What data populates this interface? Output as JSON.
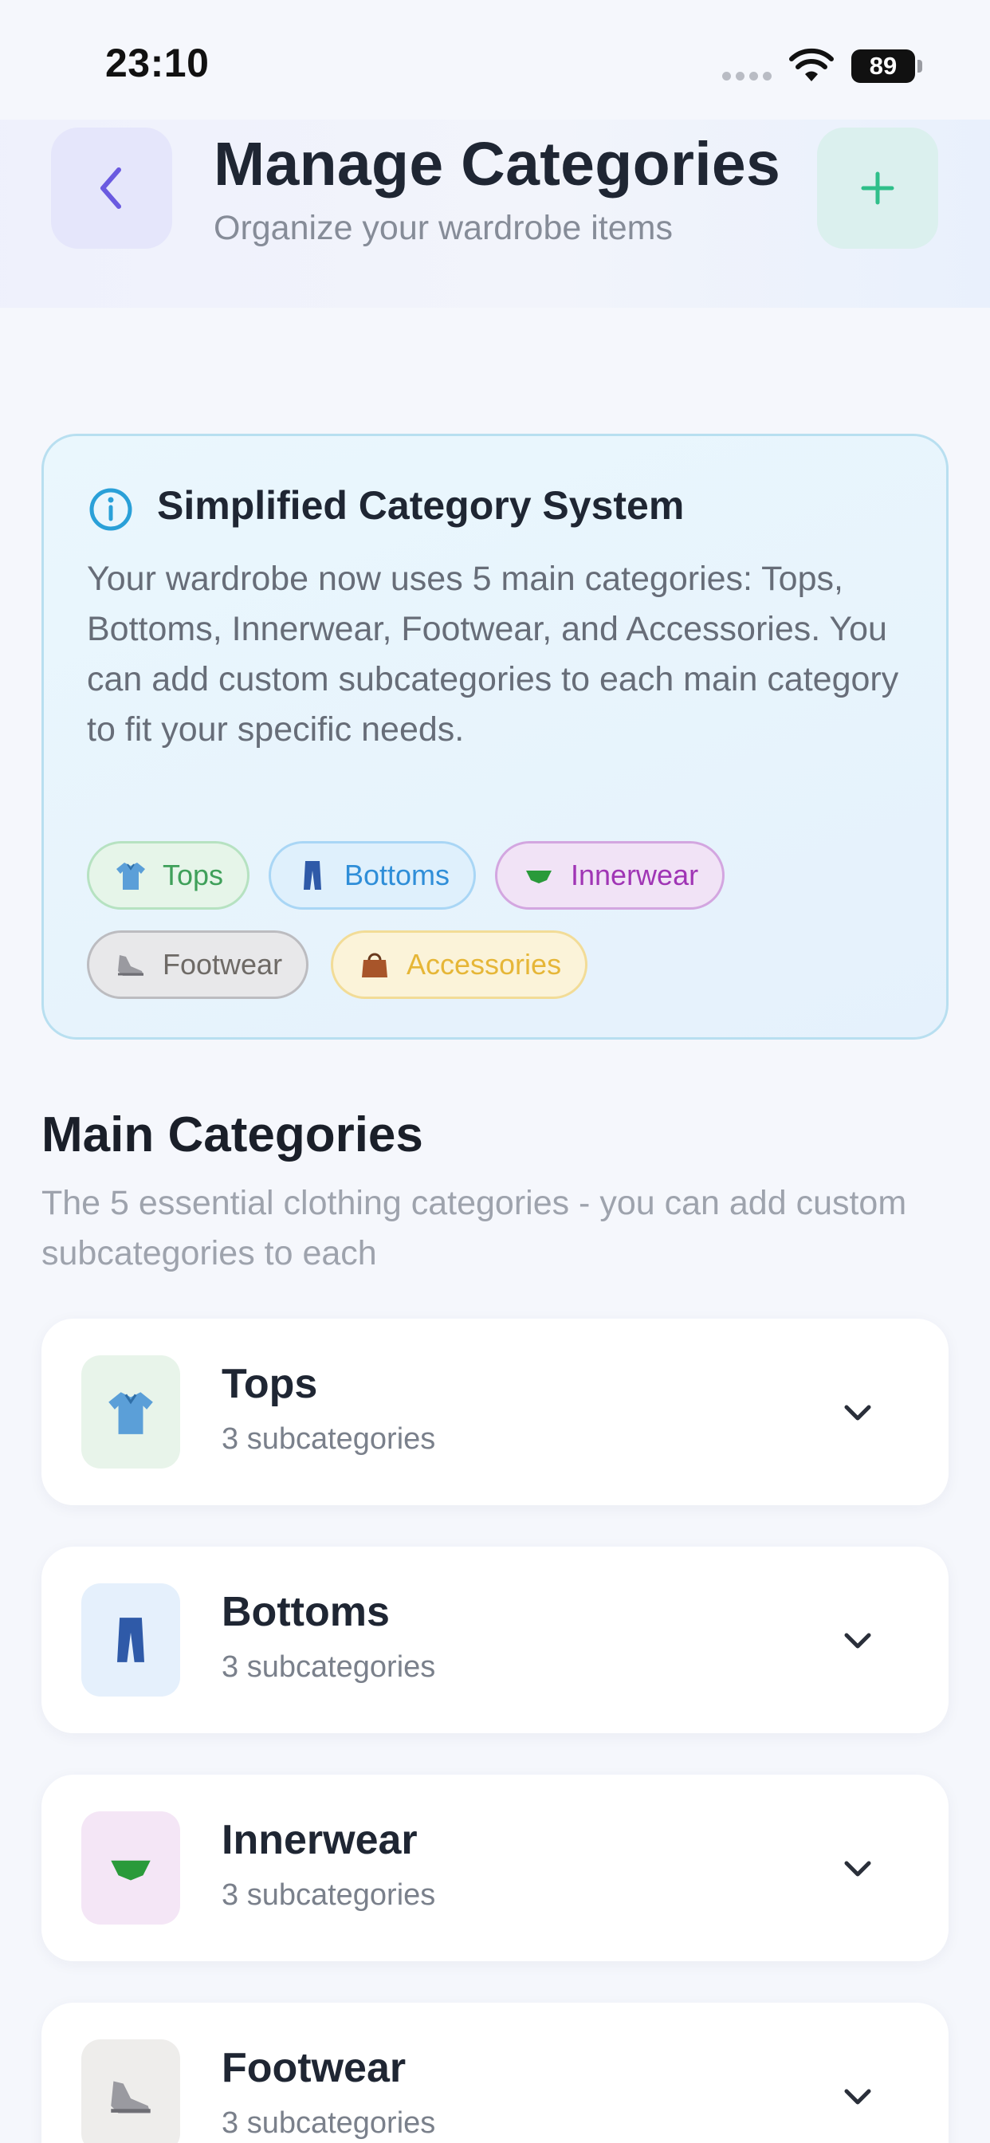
{
  "status_bar": {
    "time": "23:10",
    "battery": "89"
  },
  "header": {
    "title": "Manage Categories",
    "subtitle": "Organize your wardrobe items",
    "back_icon": "chevron-left-icon",
    "add_icon": "plus-icon"
  },
  "info_card": {
    "title": "Simplified Category System",
    "body": "Your wardrobe now uses 5 main categories: Tops, Bottoms, Innerwear, Footwear, and Accessories. You can add custom subcategories to each main category to fit your specific needs.",
    "chips": [
      {
        "label": "Tops",
        "icon": "shirt-icon",
        "color": "#3fa05a"
      },
      {
        "label": "Bottoms",
        "icon": "jeans-icon",
        "color": "#2f8ed8"
      },
      {
        "label": "Innerwear",
        "icon": "briefs-icon",
        "color": "#a035b5"
      },
      {
        "label": "Footwear",
        "icon": "shoe-icon",
        "color": "#6e6a66"
      },
      {
        "label": "Accessories",
        "icon": "handbag-icon",
        "color": "#e6b637"
      }
    ]
  },
  "section": {
    "title": "Main Categories",
    "subtitle": "The 5 essential clothing categories - you can add custom subcategories to each"
  },
  "categories": [
    {
      "name": "Tops",
      "count_label": "3 subcategories",
      "icon": "shirt-icon"
    },
    {
      "name": "Bottoms",
      "count_label": "3 subcategories",
      "icon": "jeans-icon"
    },
    {
      "name": "Innerwear",
      "count_label": "3 subcategories",
      "icon": "briefs-icon"
    },
    {
      "name": "Footwear",
      "count_label": "3 subcategories",
      "icon": "shoe-icon"
    }
  ],
  "colors": {
    "accent_purple": "#6a5ae0",
    "accent_teal": "#2fbf8a",
    "info_blue": "#2aa0d8"
  }
}
